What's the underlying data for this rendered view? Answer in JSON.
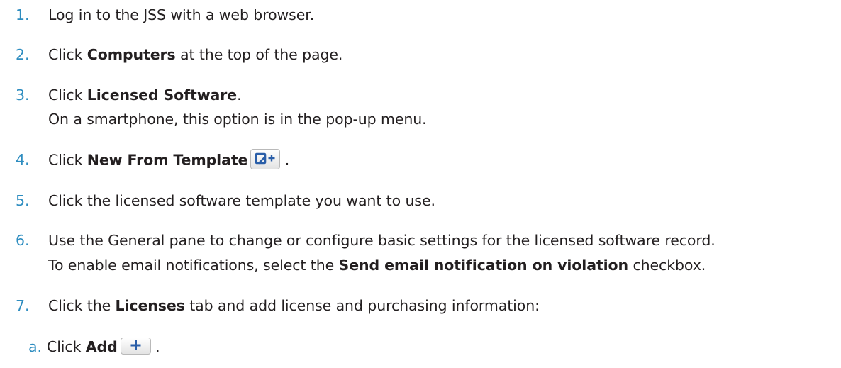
{
  "steps": [
    {
      "num": "1.",
      "pre": "Log in to the JSS with a web browser."
    },
    {
      "num": "2.",
      "pre": "Click ",
      "bold": "Computers",
      "post": " at the top of the page."
    },
    {
      "num": "3.",
      "pre": "Click ",
      "bold": "Licensed Software",
      "post": ".",
      "note": "On a smartphone, this option is in the pop-up menu."
    },
    {
      "num": "4.",
      "pre": "Click ",
      "bold": "New From Template",
      "post": ".",
      "icon": "new-from-template-icon"
    },
    {
      "num": "5.",
      "pre": "Click the licensed software template you want to use."
    },
    {
      "num": "6.",
      "pre": "Use the General pane to change or configure basic settings for the licensed software record.",
      "note_pre": "To enable email notifications, select the ",
      "note_bold": "Send email notification on violation",
      "note_post": " checkbox."
    },
    {
      "num": "7.",
      "pre": "Click the ",
      "bold": "Licenses",
      "post": " tab and add license and purchasing information:"
    }
  ],
  "substeps": [
    {
      "num": "a.",
      "pre": "Click ",
      "bold": "Add",
      "post": ".",
      "icon": "add-plus-icon"
    }
  ],
  "colors": {
    "number": "#2e8dc0",
    "text": "#231f20",
    "icon": "#2a5ea8"
  }
}
